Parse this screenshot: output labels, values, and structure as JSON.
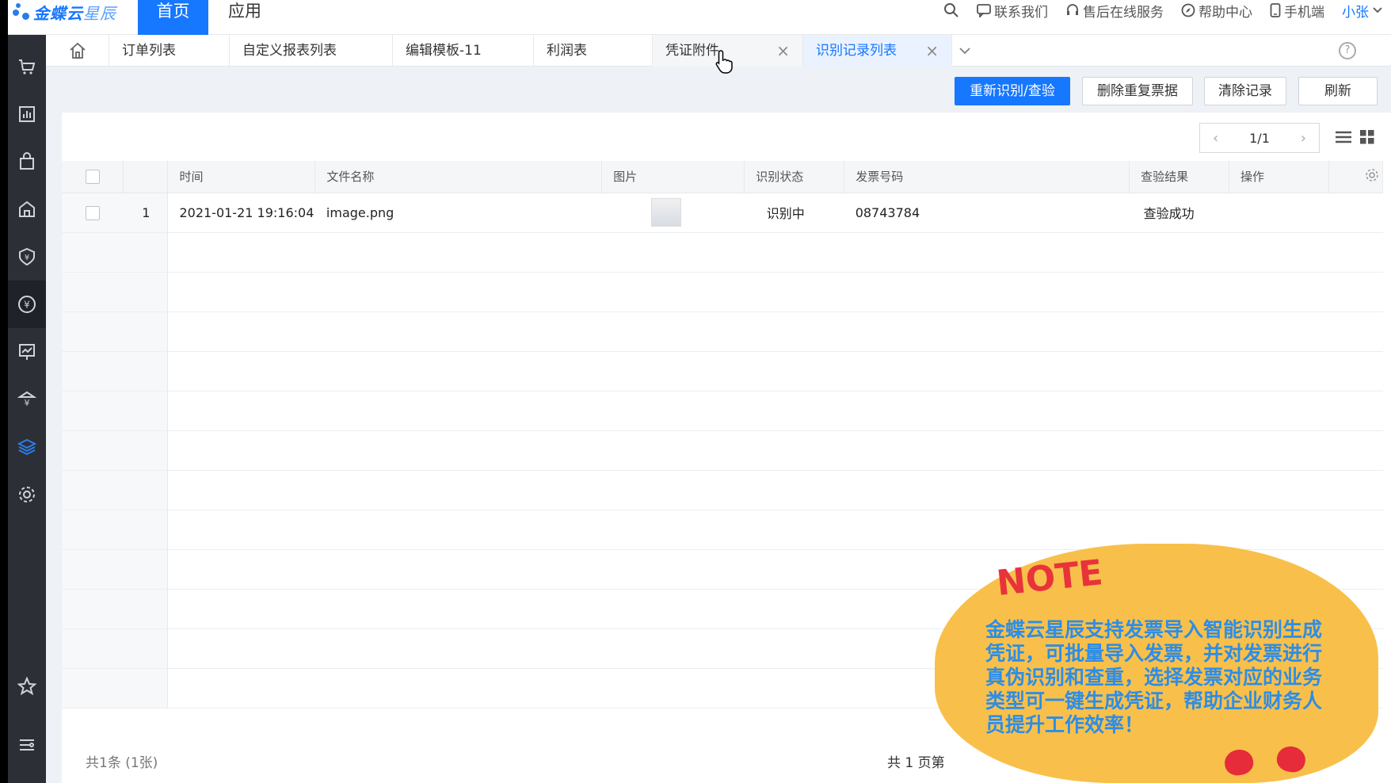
{
  "brand": {
    "name": "金蝶云",
    "product": "星辰"
  },
  "topnav": {
    "tabs": [
      {
        "label": "首页",
        "active": true
      },
      {
        "label": "应用",
        "active": false
      }
    ],
    "tools": {
      "contact": "联系我们",
      "service": "售后在线服务",
      "help": "帮助中心",
      "mobile": "手机端",
      "user": "小张"
    }
  },
  "sidebar": {
    "items": [
      {
        "icon": "store-icon"
      },
      {
        "icon": "report-icon"
      },
      {
        "icon": "bag-icon"
      },
      {
        "icon": "warehouse-icon"
      },
      {
        "icon": "yuan-shield-icon"
      },
      {
        "icon": "yuan-circle-icon",
        "active": true
      },
      {
        "icon": "chart-board-icon"
      },
      {
        "icon": "bank-icon"
      },
      {
        "icon": "layers-icon",
        "highlight": true
      },
      {
        "icon": "gear-icon"
      },
      {
        "icon": "star-icon"
      },
      {
        "icon": "menu-settings-icon"
      }
    ]
  },
  "tabbar": {
    "tabs": [
      {
        "label": "订单列表"
      },
      {
        "label": "自定义报表列表"
      },
      {
        "label": "编辑模板-11"
      },
      {
        "label": "利润表"
      },
      {
        "label": "凭证附件",
        "closable": true,
        "hover": true
      },
      {
        "label": "识别记录列表",
        "closable": true,
        "active": true
      }
    ],
    "help": "?"
  },
  "toolbar": {
    "recognize": "重新识别/查验",
    "delete_dup": "删除重复票据",
    "clear": "清除记录",
    "refresh": "刷新"
  },
  "pager": {
    "page": "1/1"
  },
  "table": {
    "headers": [
      "时间",
      "文件名称",
      "图片",
      "识别状态",
      "发票号码",
      "查验结果",
      "操作"
    ],
    "rows": [
      {
        "seq": "1",
        "time": "2021-01-21 19:16:04",
        "file": "image.png",
        "status": "识别中",
        "invoice_no": "08743784",
        "check_result": "查验成功",
        "op": ""
      }
    ]
  },
  "footer": {
    "total": "共1条 (1张)",
    "pages": "共 1 页第"
  },
  "note": {
    "title": "NOTE",
    "text": "金蝶云星辰支持发票导入智能识别生成凭证，可批量导入发票，并对发票进行真伪识别和查重，选择发票对应的业务类型可一键生成凭证，帮助企业财务人员提升工作效率！"
  },
  "colors": {
    "accent": "#1677ff",
    "sidebar": "#2c2f36",
    "note_bg": "#f8c04a",
    "note_text": "#2e8de6",
    "note_title": "#e8333a"
  }
}
